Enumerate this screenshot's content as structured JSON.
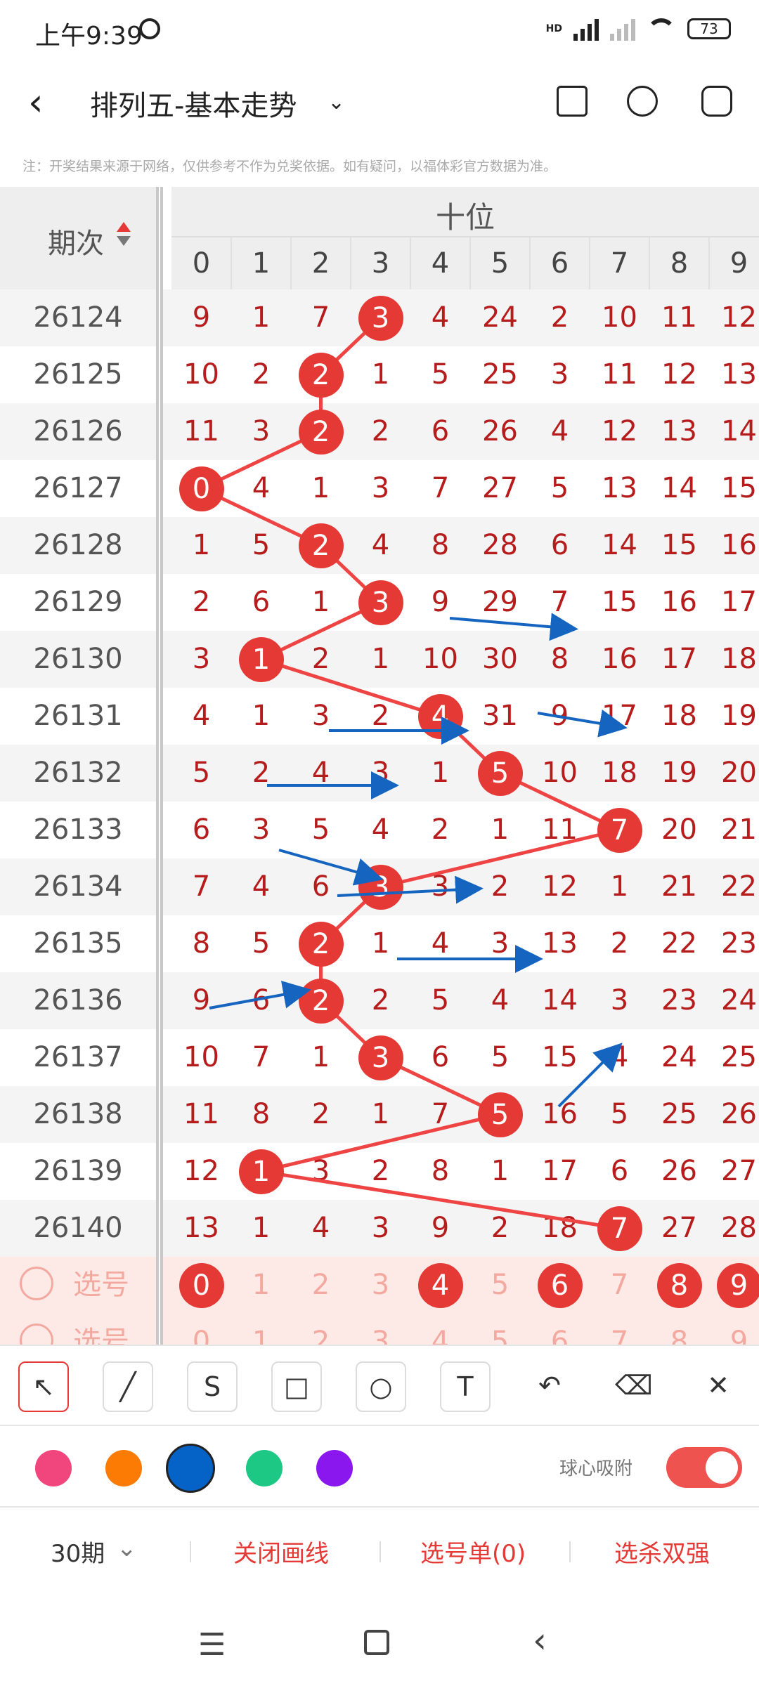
{
  "status_bar": {
    "time": "上午9:39",
    "battery": "73",
    "hd": "HD"
  },
  "header": {
    "title": "排列五-基本走势"
  },
  "note": "注：开奖结果来源于网络，仅供参考不作为兑奖依据。如有疑问，以福体彩官方数据为准。",
  "table": {
    "issue_header": "期次",
    "group_header": "十位",
    "digits": [
      "0",
      "1",
      "2",
      "3",
      "4",
      "5",
      "6",
      "7",
      "8",
      "9"
    ],
    "rows": [
      {
        "issue": "26124",
        "cells": [
          "9",
          "1",
          "7",
          "3",
          "4",
          "24",
          "2",
          "10",
          "11",
          "12"
        ],
        "hit": 3
      },
      {
        "issue": "26125",
        "cells": [
          "10",
          "2",
          "2",
          "1",
          "5",
          "25",
          "3",
          "11",
          "12",
          "13"
        ],
        "hit": 2
      },
      {
        "issue": "26126",
        "cells": [
          "11",
          "3",
          "2",
          "2",
          "6",
          "26",
          "4",
          "12",
          "13",
          "14"
        ],
        "hit": 2
      },
      {
        "issue": "26127",
        "cells": [
          "0",
          "4",
          "1",
          "3",
          "7",
          "27",
          "5",
          "13",
          "14",
          "15"
        ],
        "hit": 0
      },
      {
        "issue": "26128",
        "cells": [
          "1",
          "5",
          "2",
          "4",
          "8",
          "28",
          "6",
          "14",
          "15",
          "16"
        ],
        "hit": 2
      },
      {
        "issue": "26129",
        "cells": [
          "2",
          "6",
          "1",
          "3",
          "9",
          "29",
          "7",
          "15",
          "16",
          "17"
        ],
        "hit": 3
      },
      {
        "issue": "26130",
        "cells": [
          "3",
          "1",
          "2",
          "1",
          "10",
          "30",
          "8",
          "16",
          "17",
          "18"
        ],
        "hit": 1
      },
      {
        "issue": "26131",
        "cells": [
          "4",
          "1",
          "3",
          "2",
          "4",
          "31",
          "9",
          "17",
          "18",
          "19"
        ],
        "hit": 4
      },
      {
        "issue": "26132",
        "cells": [
          "5",
          "2",
          "4",
          "3",
          "1",
          "5",
          "10",
          "18",
          "19",
          "20"
        ],
        "hit": 5
      },
      {
        "issue": "26133",
        "cells": [
          "6",
          "3",
          "5",
          "4",
          "2",
          "1",
          "11",
          "7",
          "20",
          "21"
        ],
        "hit": 7
      },
      {
        "issue": "26134",
        "cells": [
          "7",
          "4",
          "6",
          "3",
          "3",
          "2",
          "12",
          "1",
          "21",
          "22"
        ],
        "hit": 3
      },
      {
        "issue": "26135",
        "cells": [
          "8",
          "5",
          "2",
          "1",
          "4",
          "3",
          "13",
          "2",
          "22",
          "23"
        ],
        "hit": 2
      },
      {
        "issue": "26136",
        "cells": [
          "9",
          "6",
          "2",
          "2",
          "5",
          "4",
          "14",
          "3",
          "23",
          "24"
        ],
        "hit": 2
      },
      {
        "issue": "26137",
        "cells": [
          "10",
          "7",
          "1",
          "3",
          "6",
          "5",
          "15",
          "4",
          "24",
          "25"
        ],
        "hit": 3
      },
      {
        "issue": "26138",
        "cells": [
          "11",
          "8",
          "2",
          "1",
          "7",
          "5",
          "16",
          "5",
          "25",
          "26"
        ],
        "hit": 5
      },
      {
        "issue": "26139",
        "cells": [
          "12",
          "1",
          "3",
          "2",
          "8",
          "1",
          "17",
          "6",
          "26",
          "27"
        ],
        "hit": 1
      },
      {
        "issue": "26140",
        "cells": [
          "13",
          "1",
          "4",
          "3",
          "9",
          "2",
          "18",
          "7",
          "27",
          "28"
        ],
        "hit": 7
      }
    ],
    "select_rows": [
      {
        "label": "选号",
        "selected": [
          0,
          4,
          6,
          8,
          9
        ]
      },
      {
        "label": "选号",
        "selected": []
      }
    ]
  },
  "toolbar": {
    "tools": [
      {
        "name": "arrow-tool",
        "glyph": "↖",
        "active": true
      },
      {
        "name": "line-tool",
        "glyph": "╱",
        "active": false
      },
      {
        "name": "curve-tool",
        "glyph": "S",
        "active": false
      },
      {
        "name": "rect-tool",
        "glyph": "□",
        "active": false
      },
      {
        "name": "circle-tool",
        "glyph": "○",
        "active": false
      },
      {
        "name": "text-tool",
        "glyph": "T",
        "active": false
      },
      {
        "name": "undo-tool",
        "glyph": "↶",
        "active": false
      },
      {
        "name": "eraser-tool",
        "glyph": "⌫",
        "active": false
      },
      {
        "name": "clear-tool",
        "glyph": "✕",
        "active": false
      }
    ],
    "colors": [
      "#f0457d",
      "#fb7b05",
      "#0563c7",
      "#1dc784",
      "#8a17ee"
    ],
    "selected_color": "#0563c7",
    "snap_label": "球心吸附",
    "snap_on": true
  },
  "bottom_bar": {
    "period": "30期",
    "close_draw": "关闭画线",
    "pick_list": "选号单(0)",
    "kill": "选杀双强"
  },
  "colors": {
    "accent": "#e53935",
    "cell_text": "#b71c1c",
    "draw": "#1565c0"
  }
}
